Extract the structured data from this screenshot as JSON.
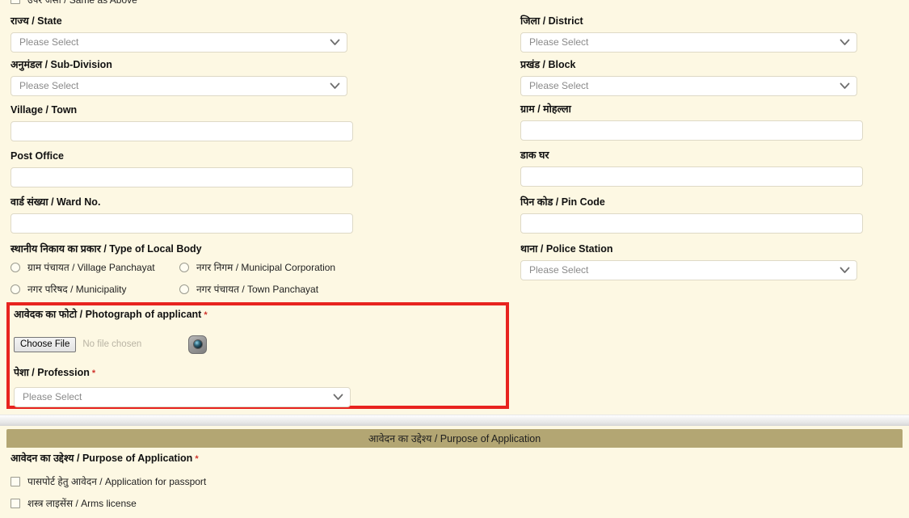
{
  "address_section": {
    "same_as_above": {
      "label": "उपर जैसा / Same as Above",
      "checked": false
    },
    "left_column": {
      "state": {
        "label": "राज्य / State",
        "value": "Please Select"
      },
      "sub_division": {
        "label": "अनुमंडल / Sub-Division",
        "value": "Please Select"
      },
      "village_town": {
        "label": "Village / Town",
        "value": ""
      },
      "post_office": {
        "label": "Post Office",
        "value": ""
      },
      "ward_no": {
        "label": "वार्ड संख्या / Ward No.",
        "value": ""
      },
      "local_body": {
        "label": "स्थानीय निकाय का प्रकार / Type of Local Body",
        "options": [
          {
            "label": "ग्राम पंचायत / Village Panchayat",
            "selected": false
          },
          {
            "label": "नगर निगम / Municipal Corporation",
            "selected": false
          },
          {
            "label": "नगर परिषद / Municipality",
            "selected": false
          },
          {
            "label": "नगर पंचायत / Town Panchayat",
            "selected": false
          }
        ]
      }
    },
    "right_column": {
      "district": {
        "label": "जिला / District",
        "value": "Please Select"
      },
      "block": {
        "label": "प्रखंड / Block",
        "value": "Please Select"
      },
      "gram_mohalla": {
        "label": "ग्राम / मोहल्ला",
        "value": ""
      },
      "dak_ghar": {
        "label": "डाक घर",
        "value": ""
      },
      "pin_code": {
        "label": "पिन कोड / Pin Code",
        "value": ""
      },
      "police_station": {
        "label": "थाना / Police Station",
        "value": "Please Select"
      }
    }
  },
  "photo_section": {
    "photo": {
      "label": "आवेदक का फोटो / Photograph of applicant",
      "required_marker": "*",
      "choose_button": "Choose File",
      "file_status": "No file chosen",
      "camera_icon": "camera-icon"
    },
    "profession": {
      "label": "पेशा / Profession",
      "required_marker": "*",
      "value": "Please Select"
    },
    "highlight_color": "#e8231f"
  },
  "purpose_section": {
    "header_bar": {
      "title": "आवेदन का उद्देश्य / Purpose of Application",
      "background_color": "#b3a673"
    },
    "field_label": "आवेदन का उद्देश्य / Purpose of Application",
    "required_marker": "*",
    "options": [
      {
        "label": "पासपोर्ट हेतु आवेदन / Application for passport",
        "checked": false
      },
      {
        "label": "शस्त्र लाइसेंस / Arms license",
        "checked": false
      }
    ]
  },
  "theme": {
    "page_background": "#fdf8e3",
    "input_background": "#ffffff",
    "input_border": "#ded9c6",
    "required_color": "#d0342c"
  }
}
